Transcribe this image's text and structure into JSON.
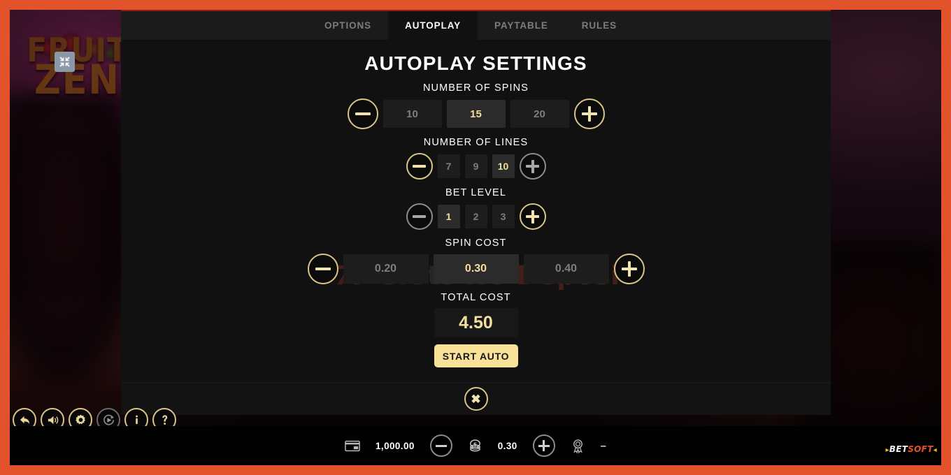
{
  "game": {
    "logo_line1": "FRUIT",
    "logo_line2": "ZEN",
    "fullscreen_icon": "fullscreen-collapse-icon"
  },
  "watermark": {
    "sevens": "777",
    "part1": "Slot",
    "part2": "s No ",
    "part3": "Deposit"
  },
  "tabs": [
    {
      "label": "OPTIONS",
      "active": false
    },
    {
      "label": "AUTOPLAY",
      "active": true
    },
    {
      "label": "PAYTABLE",
      "active": false
    },
    {
      "label": "RULES",
      "active": false
    }
  ],
  "modal": {
    "title": "AUTOPLAY SETTINGS",
    "close_icon": "close-x-icon",
    "sections": {
      "spins": {
        "label": "NUMBER OF SPINS",
        "minus_enabled": true,
        "plus_enabled": true,
        "options": [
          "10",
          "15",
          "20"
        ],
        "selected_index": 1
      },
      "lines": {
        "label": "NUMBER OF LINES",
        "minus_enabled": true,
        "plus_enabled": false,
        "options": [
          "7",
          "9",
          "10"
        ],
        "selected_index": 2
      },
      "bet_level": {
        "label": "BET LEVEL",
        "minus_enabled": false,
        "plus_enabled": true,
        "options": [
          "1",
          "2",
          "3"
        ],
        "selected_index": 0
      },
      "spin_cost": {
        "label": "SPIN COST",
        "minus_enabled": true,
        "plus_enabled": true,
        "options": [
          "0.20",
          "0.30",
          "0.40"
        ],
        "selected_index": 1
      },
      "total_cost": {
        "label": "TOTAL COST",
        "value": "4.50"
      }
    },
    "start_button": "START AUTO"
  },
  "controls": [
    {
      "name": "back-button",
      "icon": "back-arrow-icon",
      "enabled": true
    },
    {
      "name": "sound-button",
      "icon": "volume-icon",
      "enabled": true
    },
    {
      "name": "settings-button",
      "icon": "gear-icon",
      "enabled": true
    },
    {
      "name": "autoplay-button",
      "icon": "autoplay-icon",
      "enabled": false
    },
    {
      "name": "info-button",
      "icon": "info-icon",
      "enabled": true
    },
    {
      "name": "help-button",
      "icon": "question-icon",
      "enabled": true
    }
  ],
  "statusbar": {
    "wallet_icon": "wallet-card-icon",
    "balance": "1,000.00",
    "bet_minus_icon": "minus-icon",
    "coins_icon": "coins-stack-icon",
    "bet": "0.30",
    "bet_plus_icon": "plus-icon",
    "win_icon": "award-medal-icon",
    "win": "–"
  },
  "branding": {
    "prefix": "▸",
    "part1": "BET",
    "part2": "SOFT",
    "suffix": "◂"
  },
  "colors": {
    "frame": "#e2532c",
    "gold": "#d9c587",
    "gold_text": "#f2de9e",
    "button_bg": "#fae198",
    "panel": "#111111",
    "tabbar": "#1b1b1b",
    "cell": "#1d1d1d",
    "cell_selected": "#2b2b2b",
    "accent_line": "#8f1f14"
  }
}
